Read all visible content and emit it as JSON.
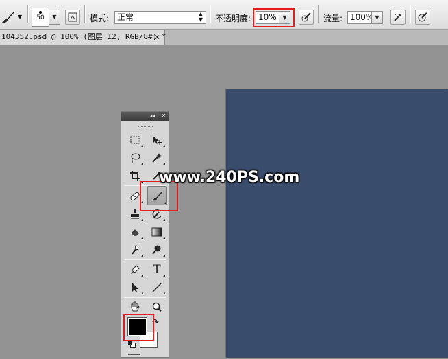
{
  "options_bar": {
    "brush_size": "50",
    "mode_label": "模式:",
    "mode_value": "正常",
    "opacity_label": "不透明度:",
    "opacity_value": "10%",
    "flow_label": "流量:",
    "flow_value": "100%"
  },
  "document_tab": {
    "title": "104352.psd @ 100% (图层 12, RGB/8#) *",
    "close_glyph": "×"
  },
  "tools_panel": {
    "collapse_glyph": "◂◂",
    "close_glyph": "×",
    "type_tool_glyph": "T"
  },
  "watermark": "www.240PS.com",
  "colors": {
    "canvas": "#3a4c6b",
    "foreground": "#000000",
    "background": "#ffffff",
    "highlight": "#e21d1d"
  }
}
